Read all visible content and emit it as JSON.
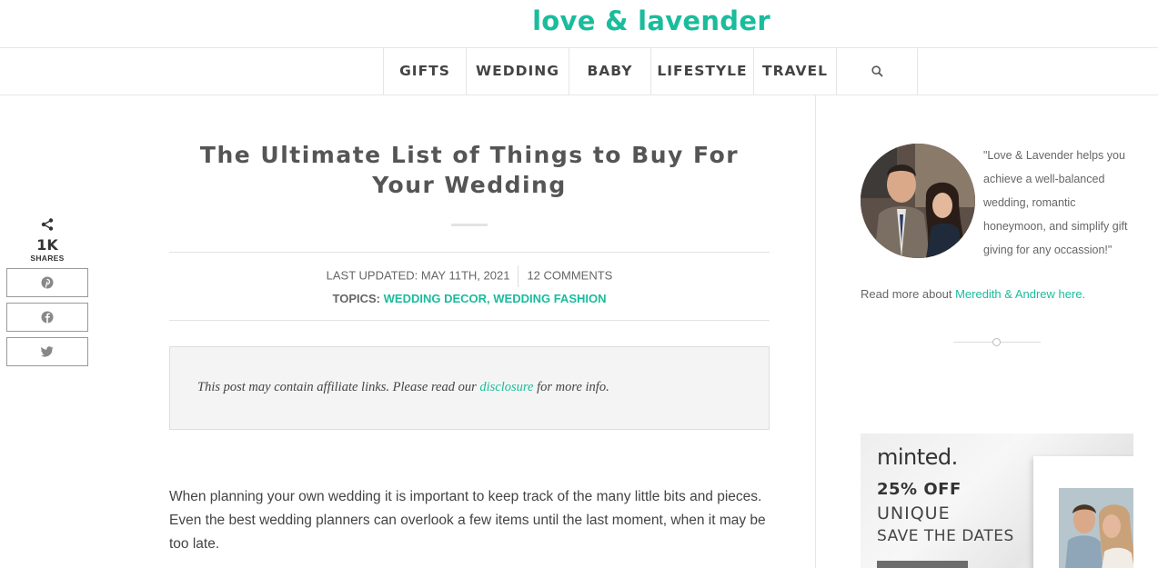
{
  "site": {
    "logo": "love & lavender"
  },
  "nav": {
    "items": [
      "GIFTS",
      "WEDDING",
      "BABY",
      "LIFESTYLE",
      "TRAVEL"
    ],
    "search_icon": "search-icon"
  },
  "share": {
    "icon": "share-icon",
    "count": "1K",
    "label": "SHARES",
    "buttons": [
      "pinterest-icon",
      "facebook-icon",
      "twitter-icon"
    ]
  },
  "article": {
    "title": "The Ultimate List of Things to Buy For Your Wedding",
    "last_updated": "LAST UPDATED: MAY 11TH, 2021",
    "comments": "12 COMMENTS",
    "topics_label": "TOPICS:",
    "topic_1": "WEDDING DECOR",
    "topic_sep": ",",
    "topic_2": "WEDDING FASHION",
    "disclosure_before": "This post may contain affiliate links. Please read our",
    "disclosure_link": "disclosure",
    "disclosure_after": "for more info.",
    "intro": "When planning your own wedding it is important to keep track of the many little bits and pieces. Even the best wedding planners can overlook a few items until the last moment, when it may be too late."
  },
  "sidebar": {
    "quote": "\"Love & Lavender helps you achieve a well-balanced wedding, romantic honeymoon, and simplify gift giving for any occassion!\"",
    "read_more_text": "Read more about",
    "read_more_link": "Meredith & Andrew here."
  },
  "ad": {
    "brand": "minted.",
    "offer": "25% OFF",
    "line1": "UNIQUE",
    "line2": "SAVE THE DATES"
  },
  "colors": {
    "accent": "#1abc9c",
    "text": "#555555",
    "border": "#e6e6e6"
  }
}
